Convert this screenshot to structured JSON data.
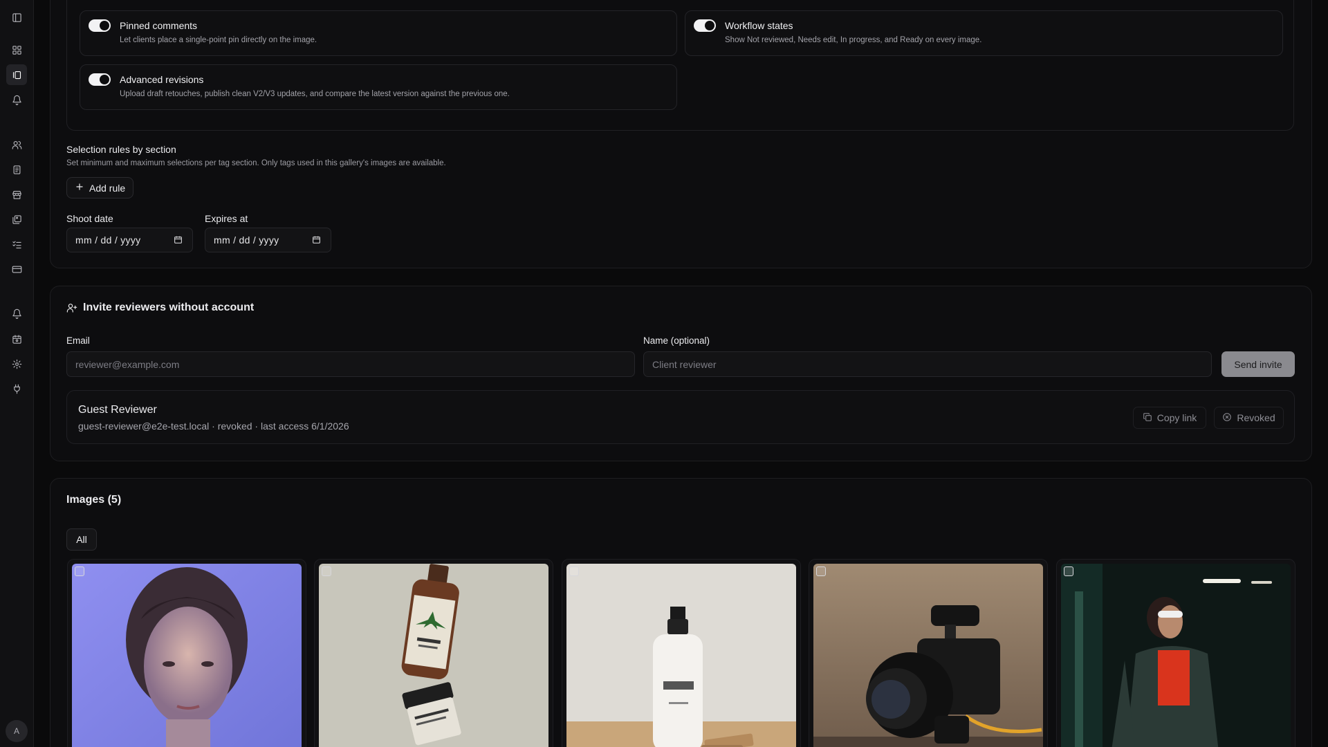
{
  "sidebar": {
    "avatar_initial": "A",
    "icons": [
      "sidebar-toggle-icon",
      "dashboard-icon",
      "galleries-icon",
      "notifications-icon",
      "users-icon",
      "documents-icon",
      "store-icon",
      "images-icon",
      "checklist-icon",
      "billing-icon",
      "alerts-icon",
      "calendar-icon",
      "settings-icon",
      "plugin-icon"
    ]
  },
  "features": {
    "pinned": {
      "title": "Pinned comments",
      "desc": "Let clients place a single-point pin directly on the image."
    },
    "workflow": {
      "title": "Workflow states",
      "desc": "Show Not reviewed, Needs edit, In progress, and Ready on every image."
    },
    "revisions": {
      "title": "Advanced revisions",
      "desc": "Upload draft retouches, publish clean V2/V3 updates, and compare the latest version against the previous one."
    }
  },
  "selection_rules": {
    "title": "Selection rules by section",
    "desc": "Set minimum and maximum selections per tag section. Only tags used in this gallery's images are available.",
    "add_rule_label": "Add rule"
  },
  "dates": {
    "shoot_label": "Shoot date",
    "shoot_value": "mm / dd / yyyy",
    "expires_label": "Expires at",
    "expires_value": "mm / dd / yyyy"
  },
  "invite": {
    "title": "Invite reviewers without account",
    "email_label": "Email",
    "email_placeholder": "reviewer@example.com",
    "name_label": "Name (optional)",
    "name_placeholder": "Client reviewer",
    "send_label": "Send invite",
    "reviewer": {
      "name": "Guest Reviewer",
      "details": "guest-reviewer@e2e-test.local · revoked · last access 6/1/2026",
      "copy_label": "Copy link",
      "revoked_label": "Revoked"
    }
  },
  "images": {
    "title": "Images (5)",
    "filter_all": "All"
  }
}
